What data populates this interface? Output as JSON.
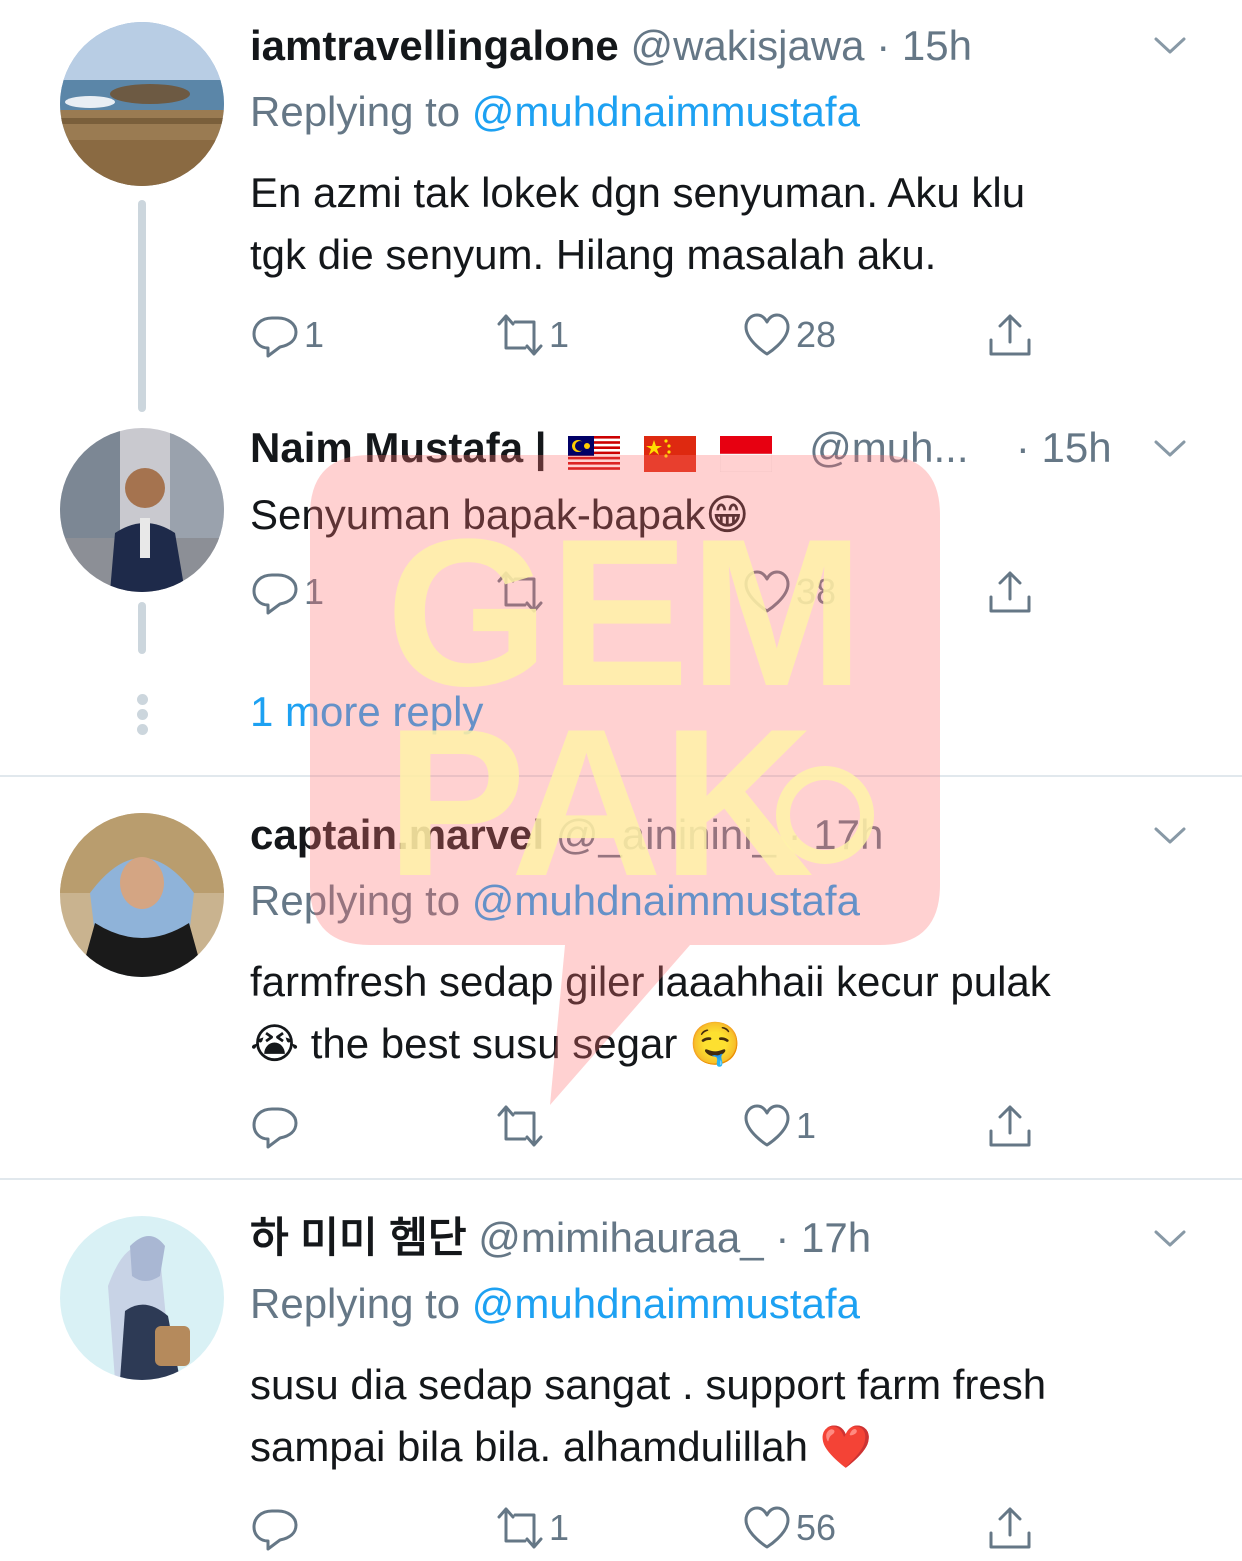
{
  "colors": {
    "accent": "#1da1f2",
    "muted": "#657786",
    "thread": "#ccd6dd"
  },
  "tweets": [
    {
      "name": "iamtravellingalone",
      "handle": "@wakisjawa",
      "dot": "·",
      "time": "15h",
      "replying_prefix": "Replying to",
      "replying_mention": "@muhdnaimmustafa",
      "body_line1": "En azmi tak lokek dgn senyuman. Aku klu",
      "body_line2": "tgk die senyum. Hilang masalah aku.",
      "reply_count": "1",
      "retweet_count": "1",
      "like_count": "28",
      "avatar_icon": "avatar-coast-photo"
    },
    {
      "name": "Naim Mustafa |",
      "flags": [
        "malaysia-flag",
        "china-flag",
        "indonesia-flag"
      ],
      "handle": "@muh...",
      "dot": "·",
      "time": "15h",
      "body": "Senyuman bapak-bapak",
      "body_emoji": "😁",
      "reply_count": "1",
      "retweet_count": "",
      "like_count": "38",
      "more_reply": "1 more reply",
      "avatar_icon": "avatar-man-in-suit-photo"
    },
    {
      "name": "captain.marvel",
      "handle": "@_aininini_",
      "dot": "·",
      "time": "17h",
      "replying_prefix": "Replying to",
      "replying_mention": "@muhdnaimmustafa",
      "body_line1": "farmfresh sedap giler laaahhaii kecur pulak",
      "body_line2_emoji1": "😭",
      "body_line2": " the best susu segar ",
      "body_line2_emoji2": "🤤",
      "reply_count": "",
      "retweet_count": "",
      "like_count": "1",
      "avatar_icon": "avatar-hijab-woman-photo"
    },
    {
      "name": "하 미미 헴단",
      "handle": "@mimihauraa_",
      "dot": "·",
      "time": "17h",
      "replying_prefix": "Replying to",
      "replying_mention": "@muhdnaimmustafa",
      "body_line1": "susu dia sedap sangat . support farm fresh",
      "body_line2": "sampai bila bila. alhamdulillah",
      "body_emoji": "❤️",
      "reply_count": "",
      "retweet_count": "1",
      "like_count": "56",
      "avatar_icon": "avatar-hijab-illustration"
    }
  ],
  "watermark": {
    "line1": "GEM",
    "line2": "PAK"
  }
}
